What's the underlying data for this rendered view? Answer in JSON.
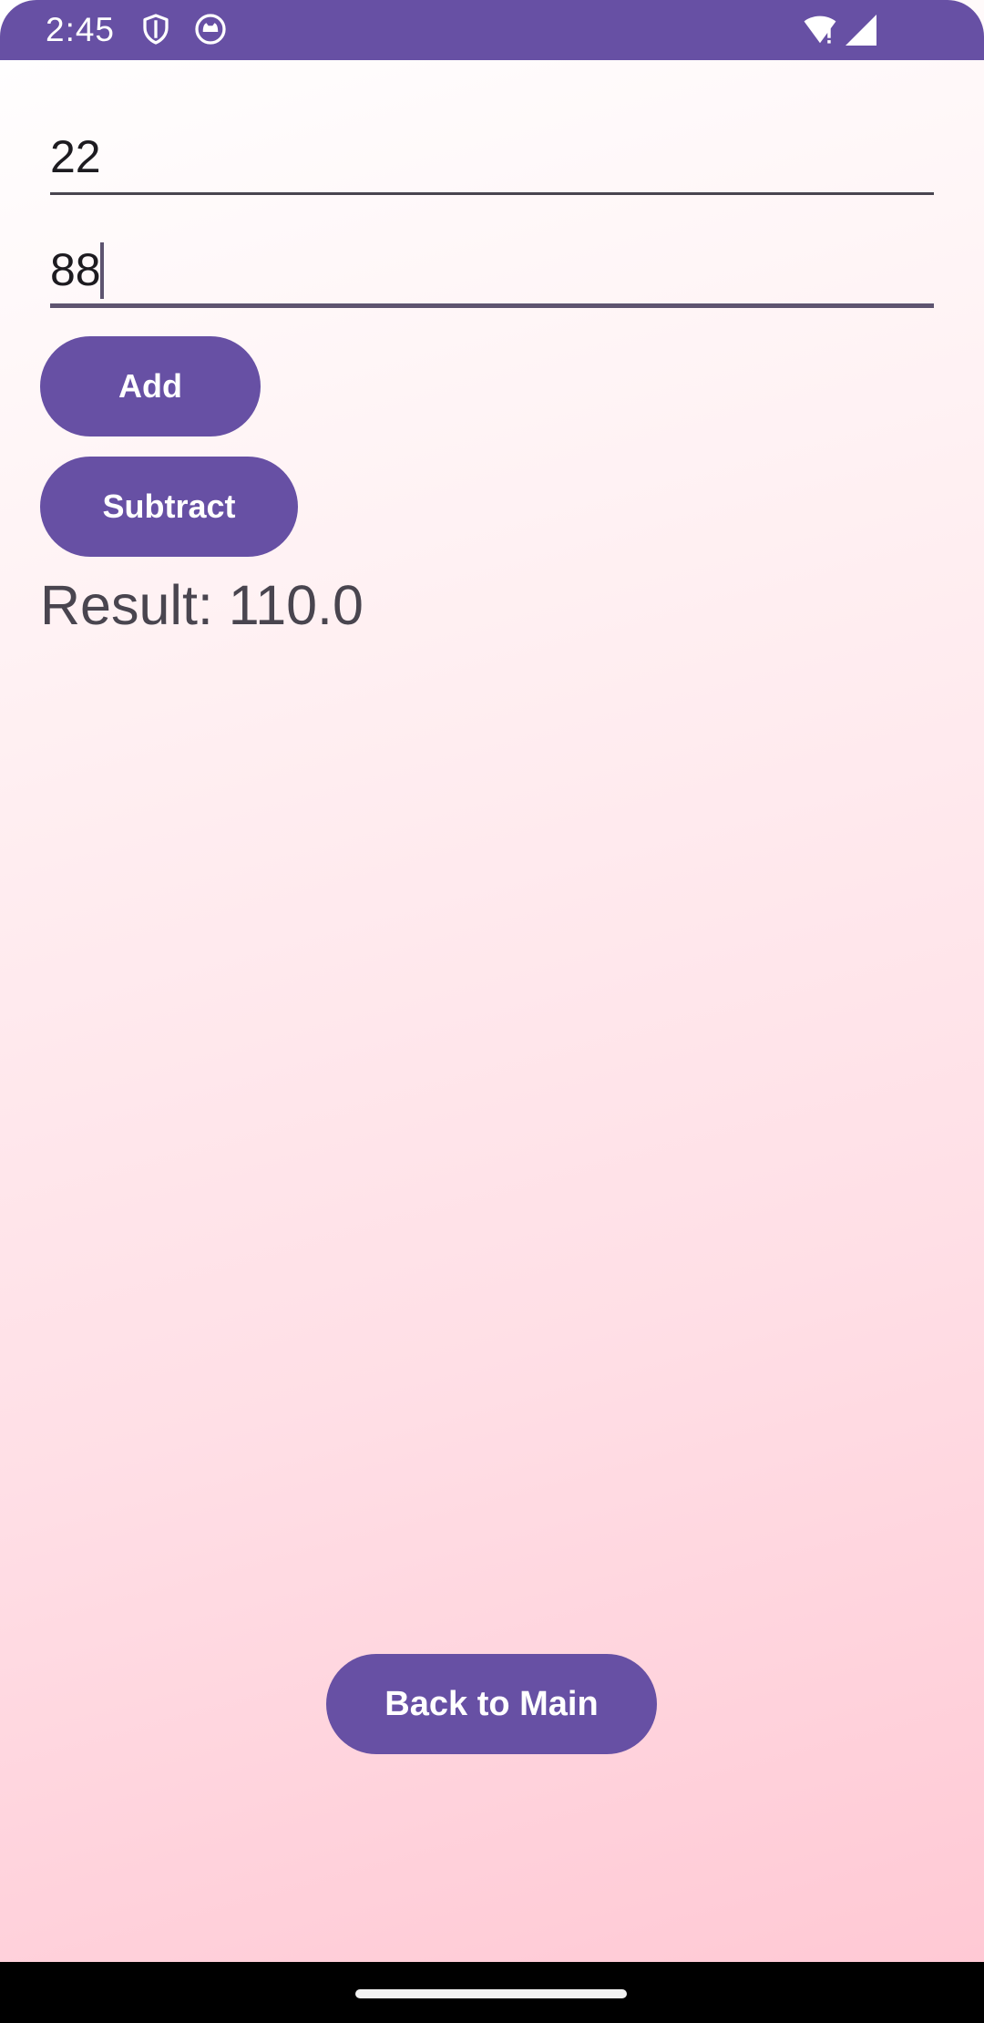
{
  "status_bar": {
    "time": "2:45",
    "icons": [
      "shield-icon",
      "cat-face-icon",
      "wifi-alert-icon",
      "cellular-signal-icon"
    ],
    "color": "#6750a4"
  },
  "form": {
    "first_number": "22",
    "second_number": "88"
  },
  "buttons": {
    "add_label": "Add",
    "subtract_label": "Subtract",
    "back_label": "Back to Main",
    "color": "#6750a4"
  },
  "result": {
    "text": "Result: 110.0"
  }
}
